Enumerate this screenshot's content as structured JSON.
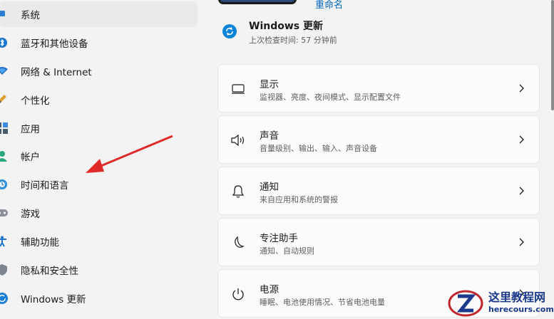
{
  "sidebar": {
    "items": [
      {
        "label": "系统",
        "icon": "system-icon",
        "selected": true
      },
      {
        "label": "蓝牙和其他设备",
        "icon": "bluetooth-icon"
      },
      {
        "label": "网络 & Internet",
        "icon": "network-icon"
      },
      {
        "label": "个性化",
        "icon": "brush-icon"
      },
      {
        "label": "应用",
        "icon": "apps-icon"
      },
      {
        "label": "帐户",
        "icon": "account-icon"
      },
      {
        "label": "时间和语言",
        "icon": "clock-globe-icon"
      },
      {
        "label": "游戏",
        "icon": "gamepad-icon"
      },
      {
        "label": "辅助功能",
        "icon": "accessibility-icon"
      },
      {
        "label": "隐私和安全性",
        "icon": "shield-icon"
      },
      {
        "label": "Windows 更新",
        "icon": "windows-update-icon"
      }
    ]
  },
  "main": {
    "rename_label": "重命名",
    "update": {
      "title": "Windows 更新",
      "subtitle": "上次检查时间: 57 分钟前"
    },
    "cards": [
      {
        "title": "显示",
        "subtitle": "监视器、亮度、夜间模式、显示配置文件",
        "icon": "display-icon"
      },
      {
        "title": "声音",
        "subtitle": "音量级别、输出、输入、声音设备",
        "icon": "speaker-icon"
      },
      {
        "title": "通知",
        "subtitle": "来自应用和系统的警报",
        "icon": "bell-icon"
      },
      {
        "title": "专注助手",
        "subtitle": "通知、自动规则",
        "icon": "moon-icon"
      },
      {
        "title": "电源",
        "subtitle": "睡眠、电池使用情况、节省电池电量",
        "icon": "power-icon"
      }
    ]
  },
  "watermark": {
    "title": "这里教程网",
    "url": "herecours.com"
  },
  "colors": {
    "accent": "#0067c0",
    "annotation_arrow": "#e02a2a",
    "background": "#f3f3f3"
  }
}
